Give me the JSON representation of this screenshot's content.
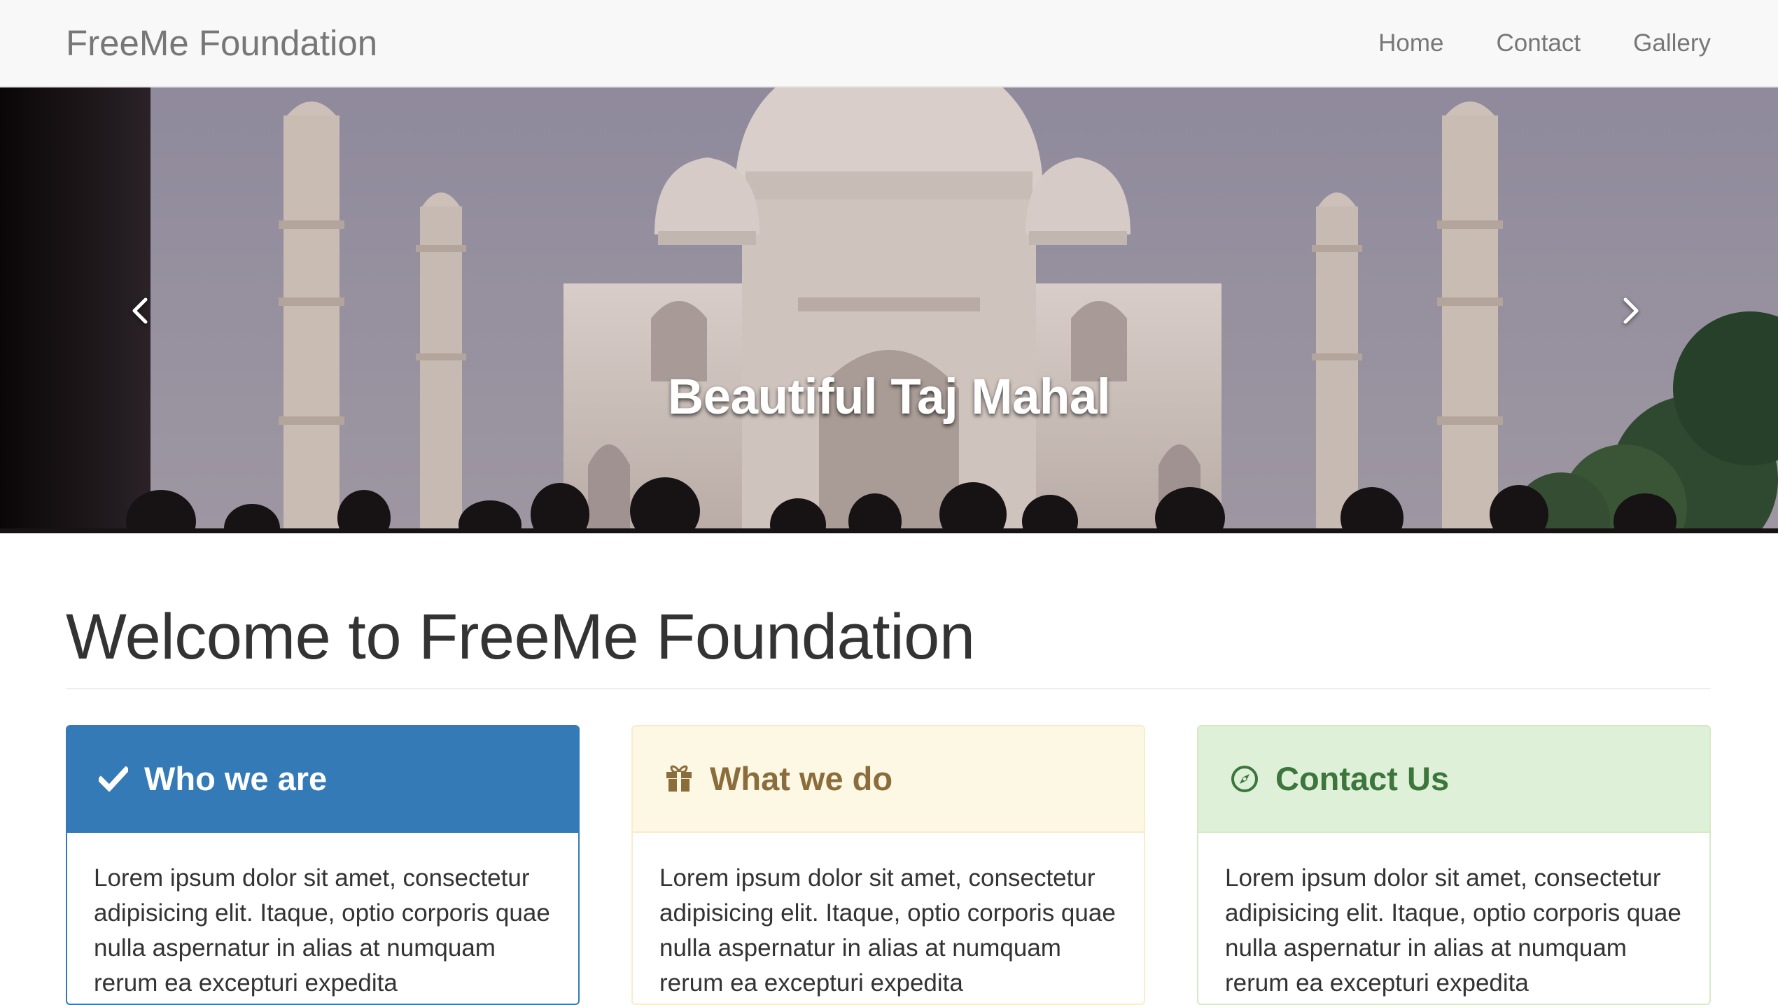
{
  "navbar": {
    "brand": "FreeMe Foundation",
    "links": [
      "Home",
      "Contact",
      "Gallery"
    ]
  },
  "carousel": {
    "caption": "Beautiful Taj Mahal",
    "slide_count": 3,
    "active_slide": 1,
    "prev_icon": "chevron-left-icon",
    "next_icon": "chevron-right-icon"
  },
  "main": {
    "title": "Welcome to FreeMe Foundation",
    "panels": [
      {
        "icon": "checkmark-icon",
        "title": "Who we are",
        "body": "Lorem ipsum dolor sit amet, consectetur adipisicing elit. Itaque, optio corporis quae nulla aspernatur in alias at numquam rerum ea excepturi expedita",
        "color": "#337ab7"
      },
      {
        "icon": "gift-icon",
        "title": "What we do",
        "body": "Lorem ipsum dolor sit amet, consectetur adipisicing elit. Itaque, optio corporis quae nulla aspernatur in alias at numquam rerum ea excepturi expedita",
        "color": "#8a6d3b"
      },
      {
        "icon": "compass-icon",
        "title": "Contact Us",
        "body": "Lorem ipsum dolor sit amet, consectetur adipisicing elit. Itaque, optio corporis quae nulla aspernatur in alias at numquam rerum ea excepturi expedita",
        "color": "#3c763d"
      }
    ]
  }
}
